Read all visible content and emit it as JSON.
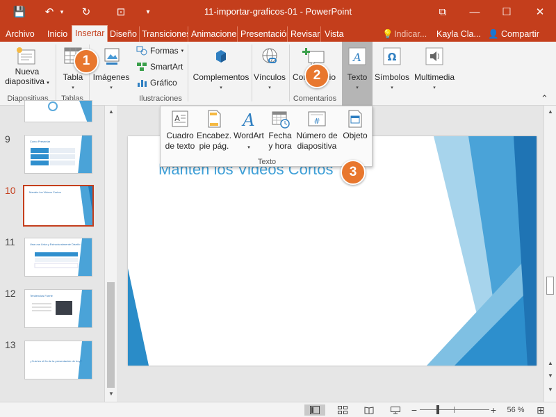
{
  "titlebar": {
    "title": "11-importar-graficos-01  -  PowerPoint",
    "save_icon": "💾",
    "undo_icon": "↶",
    "undo_caret": "▾",
    "redo_icon": "↻",
    "present_icon": "⊡",
    "customize_icon": "▾",
    "ribbon_options_icon": "⧉",
    "minimize_icon": "—",
    "maximize_icon": "☐",
    "close_icon": "✕"
  },
  "tabs": {
    "file": "Archivo",
    "items": [
      "Inicio",
      "Insertar",
      "Diseño",
      "Transiciones",
      "Animaciones",
      "Presentación",
      "Revisar",
      "Vista"
    ],
    "tell_me_icon": "💡",
    "tell_me": "Indicar...",
    "user": "Kayla Cla...",
    "share_icon": "👤",
    "share": "Compartir"
  },
  "ribbon": {
    "new_slide": "Nueva",
    "new_slide_2": "diapositiva",
    "new_slide_caret": "▾",
    "table": "Tabla",
    "images": "Imágenes",
    "shapes": "Formas",
    "shapes_caret": "▾",
    "smartart": "SmartArt",
    "chart": "Gráfico",
    "addins": "Complementos",
    "links": "Vínculos",
    "comment": "Comentario",
    "text": "Texto",
    "symbols": "Símbolos",
    "media": "Multimedia",
    "caret": "▾",
    "groups": [
      "Diapositivas",
      "Tablas",
      "Ilustraciones",
      "Comentarios"
    ],
    "collapse_icon": "⌃"
  },
  "text_dropdown": {
    "items": [
      {
        "line1": "Cuadro",
        "line2": "de texto"
      },
      {
        "line1": "Encabez.",
        "line2": "pie pág."
      },
      {
        "line1": "WordArt",
        "line2": "▾"
      },
      {
        "line1": "Fecha",
        "line2": "y hora"
      },
      {
        "line1": "Número de",
        "line2": "diapositiva"
      },
      {
        "line1": "Objeto",
        "line2": ""
      }
    ],
    "wordart_glyph": "A",
    "slide_number_glyph": "#",
    "group_label": "Texto"
  },
  "thumbnails": [
    {
      "num": "9",
      "title": "Cómo Presentar"
    },
    {
      "num": "10",
      "title": "Mantén los Videos Cortos"
    },
    {
      "num": "11",
      "title": "Usa una Lista y Estructuralmente Diseño"
    },
    {
      "num": "12",
      "title": "Tendencias Fuerte"
    },
    {
      "num": "13",
      "title": "¿Cuál es el fin de la presentación de hoy?"
    }
  ],
  "slide": {
    "title": "Mantén los Videos Cortos"
  },
  "callouts": [
    "1",
    "2",
    "3"
  ],
  "statusbar": {
    "zoom": "56 %",
    "zoom_out": "−",
    "zoom_in": "+",
    "zoom_level": 0.56,
    "fit_icon": "⊞"
  },
  "colors": {
    "accent": "#c43e1c",
    "callout": "#e8772e",
    "slide_blue": "#3fa0d8"
  }
}
